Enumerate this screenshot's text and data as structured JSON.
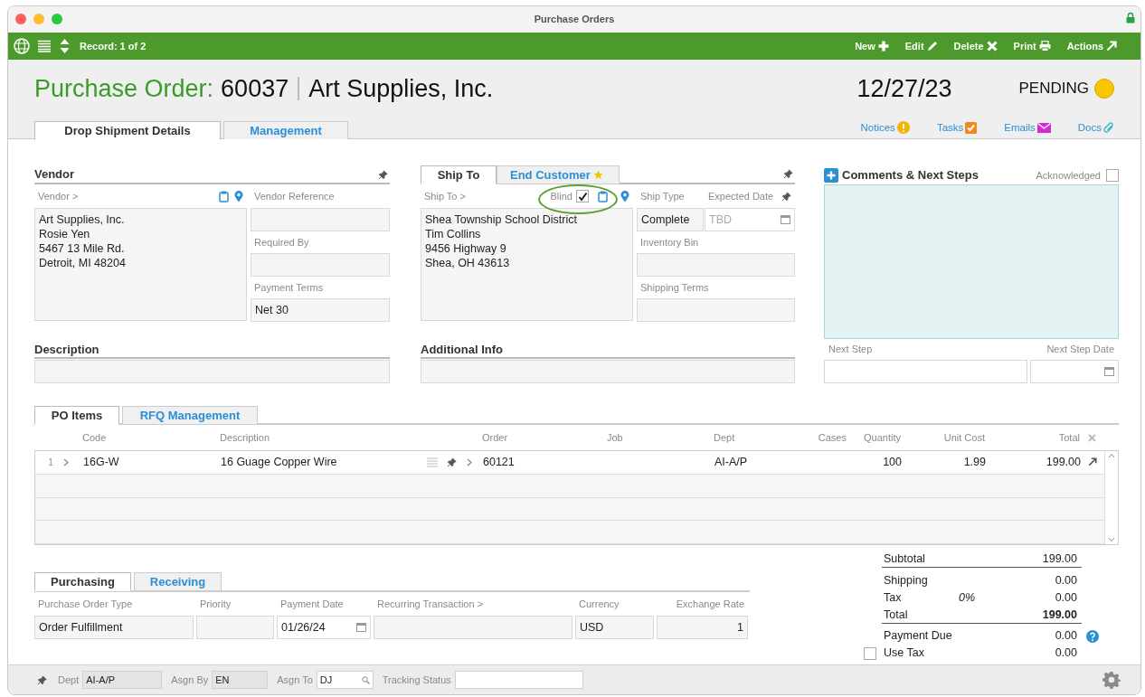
{
  "window": {
    "title": "Purchase Orders"
  },
  "toolbar": {
    "record": "Record: 1 of 2",
    "actions": [
      {
        "label": "New",
        "kind": "plus"
      },
      {
        "label": "Edit",
        "kind": "pencil"
      },
      {
        "label": "Delete",
        "kind": "cross"
      },
      {
        "label": "Print",
        "kind": "printer"
      },
      {
        "label": "Actions",
        "kind": "arrow"
      }
    ]
  },
  "header": {
    "label": "Purchase Order:",
    "number": "60037",
    "company": "Art Supplies, Inc.",
    "date": "12/27/23",
    "status": "PENDING"
  },
  "main_tabs": [
    {
      "label": "Drop Shipment Details",
      "selected": true
    },
    {
      "label": "Management",
      "selected": false
    }
  ],
  "links": [
    {
      "label": "Notices",
      "kind": "notice"
    },
    {
      "label": "Tasks",
      "kind": "task"
    },
    {
      "label": "Emails",
      "kind": "email"
    },
    {
      "label": "Docs",
      "kind": "doc"
    }
  ],
  "vendor": {
    "title": "Vendor",
    "address_label": "Vendor >",
    "address": [
      "Art Supplies, Inc.",
      "Rosie Yen",
      "5467 13 Mile Rd.",
      "Detroit, MI 48204"
    ],
    "fields": [
      {
        "label": "Vendor Reference"
      },
      {
        "label": "Required By"
      },
      {
        "label": "Payment Terms",
        "value": "Net 30"
      }
    ]
  },
  "ship": {
    "tabs": [
      {
        "label": "Ship To",
        "selected": true
      },
      {
        "label": "End Customer",
        "selected": false
      }
    ],
    "address_label": "Ship To >",
    "blind_label": "Blind",
    "blind_checked": true,
    "address": [
      "Shea Township School District",
      "Tim Collins",
      "9456 Highway 9",
      "Shea, OH 43613"
    ],
    "ship_type": {
      "label": "Ship Type",
      "value": "Complete"
    },
    "expected_date": {
      "label": "Expected Date",
      "placeholder": "TBD"
    },
    "fields": [
      {
        "label": "Inventory Bin"
      },
      {
        "label": "Shipping Terms"
      }
    ]
  },
  "comments": {
    "title": "Comments & Next Steps",
    "acknowledged_label": "Acknowledged",
    "acknowledged": false,
    "next_step_label": "Next Step",
    "next_step_date_label": "Next Step Date"
  },
  "description": {
    "title": "Description"
  },
  "additional_info": {
    "title": "Additional Info"
  },
  "items_tabs": [
    {
      "label": "PO Items",
      "selected": true
    },
    {
      "label": "RFQ Management",
      "selected": false
    }
  ],
  "items_table": {
    "columns": [
      "Code",
      "Description",
      "Order",
      "Job",
      "Dept",
      "Cases",
      "Quantity",
      "Unit Cost",
      "Total"
    ],
    "rows": [
      {
        "line": "1",
        "code": "16G-W",
        "description": "16 Guage Copper Wire",
        "order": "60121",
        "dept": "AI-A/P",
        "quantity": "100",
        "unit_cost": "1.99",
        "total": "199.00"
      }
    ]
  },
  "purchasing_tabs": [
    {
      "label": "Purchasing",
      "selected": true
    },
    {
      "label": "Receiving",
      "selected": false
    }
  ],
  "purchasing_fields": [
    {
      "label": "Purchase Order Type",
      "value": "Order Fulfillment",
      "kind": "text"
    },
    {
      "label": "Priority",
      "kind": "text"
    },
    {
      "label": "Payment Date",
      "value": "01/26/24",
      "kind": "date"
    },
    {
      "label": "Recurring Transaction >",
      "kind": "text"
    },
    {
      "label": "Currency",
      "value": "USD",
      "kind": "text"
    },
    {
      "label": "Exchange Rate",
      "value": "1",
      "kind": "number"
    }
  ],
  "totals": [
    {
      "label": "Subtotal",
      "value": "199.00",
      "kind": "subtotal"
    },
    {
      "label": "Shipping",
      "value": "0.00",
      "kind": "plain"
    },
    {
      "label": "Tax",
      "rate": "0%",
      "value": "0.00",
      "kind": "plain"
    },
    {
      "label": "Total",
      "value": "199.00",
      "kind": "total"
    },
    {
      "label": "Payment Due",
      "value": "0.00",
      "kind": "help"
    },
    {
      "label": "Use Tax",
      "value": "0.00",
      "kind": "checkbox",
      "checked": false
    }
  ],
  "status_bar": {
    "fields": [
      {
        "label": "Dept",
        "value": "AI-A/P",
        "kind": "text"
      },
      {
        "label": "Asgn By",
        "value": "EN",
        "kind": "text"
      },
      {
        "label": "Asgn To",
        "value": "DJ",
        "kind": "lookup"
      },
      {
        "label": "Tracking Status",
        "kind": "blank"
      }
    ]
  }
}
